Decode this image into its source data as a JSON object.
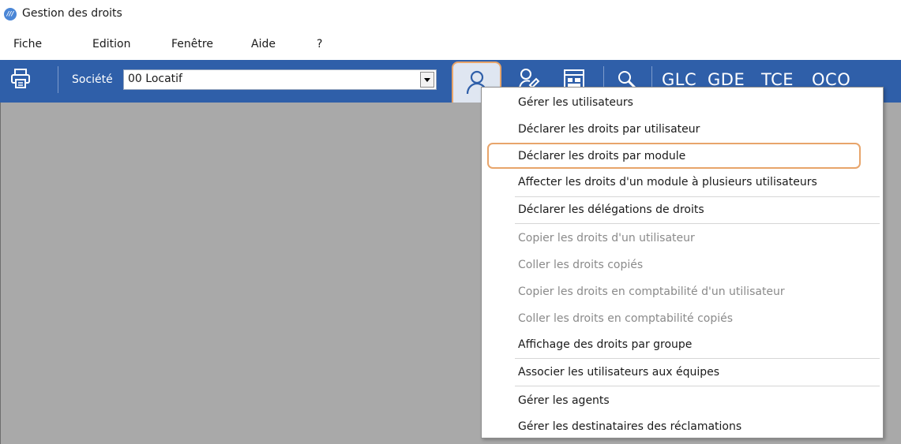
{
  "window": {
    "title": "Gestion des droits",
    "app_icon": "app-logo-icon"
  },
  "menubar": {
    "items": [
      "Fiche",
      "Edition",
      "Fenêtre",
      "Aide",
      "?"
    ]
  },
  "toolbar": {
    "company_label": "Société",
    "company_value": "00 Locatif",
    "text_buttons": [
      "GLC",
      "GDE",
      "TCE",
      "OCO"
    ],
    "icons": [
      "printer-icon",
      "user-icon",
      "rights-icon",
      "window-icon",
      "search-icon"
    ]
  },
  "context_menu": {
    "items": [
      {
        "label": "Gérer les utilisateurs",
        "enabled": true
      },
      {
        "label": "Déclarer les droits par utilisateur",
        "enabled": true
      },
      {
        "label": "Déclarer les droits par module",
        "enabled": true,
        "highlighted": true
      },
      {
        "label": "Affecter les droits d'un module à plusieurs utilisateurs",
        "enabled": true
      },
      {
        "label": "Déclarer les délégations de droits",
        "enabled": true
      },
      {
        "label": "Copier les droits d'un utilisateur",
        "enabled": false
      },
      {
        "label": "Coller les droits copiés",
        "enabled": false
      },
      {
        "label": "Copier les droits en comptabilité d'un utilisateur",
        "enabled": false
      },
      {
        "label": "Coller les droits en comptabilité copiés",
        "enabled": false
      },
      {
        "label": "Affichage des droits par groupe",
        "enabled": true
      },
      {
        "label": "Associer les utilisateurs aux équipes",
        "enabled": true
      },
      {
        "label": "Gérer les agents",
        "enabled": true
      },
      {
        "label": "Gérer les destinataires des réclamations",
        "enabled": true
      }
    ]
  },
  "colors": {
    "toolbar": "#2f5fa9",
    "highlight": "#e8a56b",
    "content_bg": "#a9a9a9",
    "disabled_text": "#8a8a8a"
  }
}
